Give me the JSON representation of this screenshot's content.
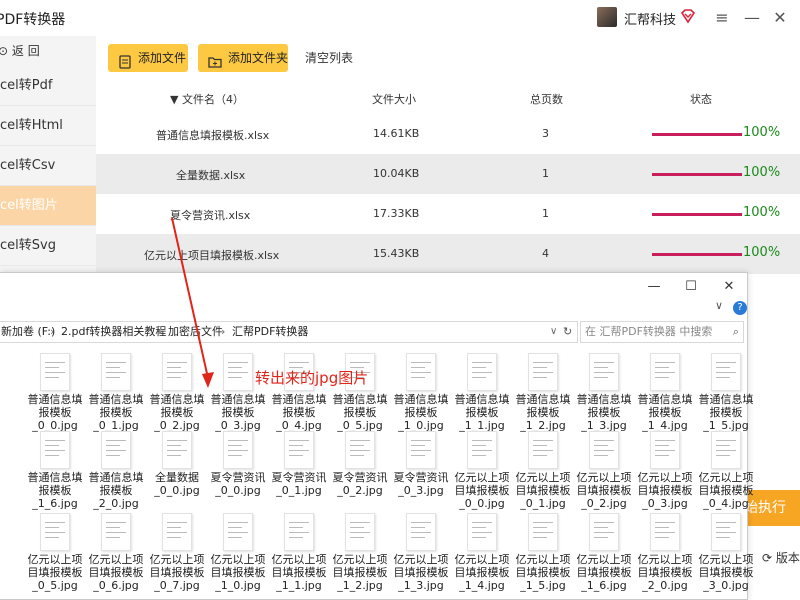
{
  "app": {
    "title": "PDF转换器",
    "brand": "汇帮科技",
    "back": "返 回",
    "sidebar": [
      {
        "label": "cel转Pdf",
        "active": false
      },
      {
        "label": "cel转Html",
        "active": false
      },
      {
        "label": "cel转Csv",
        "active": false
      },
      {
        "label": "cel转图片",
        "active": true
      },
      {
        "label": "cel转Svg",
        "active": false
      }
    ],
    "toolbar": {
      "add_file": "添加文件",
      "add_folder": "添加文件夹",
      "clear": "清空列表"
    },
    "table": {
      "headers": {
        "name": "文件名（4）",
        "size": "文件大小",
        "pages": "总页数",
        "status": "状态"
      },
      "rows": [
        {
          "name": "普通信息填报模板.xlsx",
          "size": "14.61KB",
          "pages": "3",
          "progress": 100,
          "status": "100%"
        },
        {
          "name": "全量数据.xlsx",
          "size": "10.04KB",
          "pages": "1",
          "progress": 100,
          "status": "100%"
        },
        {
          "name": "夏令营资讯.xlsx",
          "size": "17.33KB",
          "pages": "1",
          "progress": 100,
          "status": "100%"
        },
        {
          "name": "亿元以上项目填报模板.xlsx",
          "size": "15.43KB",
          "pages": "4",
          "progress": 100,
          "status": "100%"
        }
      ]
    },
    "start": "始执行",
    "version": "版本"
  },
  "explorer": {
    "path": [
      "新加卷 (F:)",
      "2.pdf转换器相关教程",
      "加密后文件",
      "汇帮PDF转换器"
    ],
    "search_placeholder": "在 汇帮PDF转换器 中搜索",
    "files": [
      [
        "普通信息填",
        "报模板",
        "_0_0.jpg"
      ],
      [
        "普通信息填",
        "报模板",
        "_0_1.jpg"
      ],
      [
        "普通信息填",
        "报模板",
        "_0_2.jpg"
      ],
      [
        "普通信息填",
        "报模板",
        "_0_3.jpg"
      ],
      [
        "普通信息填",
        "报模板",
        "_0_4.jpg"
      ],
      [
        "普通信息填",
        "报模板",
        "_0_5.jpg"
      ],
      [
        "普通信息填",
        "报模板",
        "_1_0.jpg"
      ],
      [
        "普通信息填",
        "报模板",
        "_1_1.jpg"
      ],
      [
        "普通信息填",
        "报模板",
        "_1_2.jpg"
      ],
      [
        "普通信息填",
        "报模板",
        "_1_3.jpg"
      ],
      [
        "普通信息填",
        "报模板",
        "_1_4.jpg"
      ],
      [
        "普通信息填",
        "报模板",
        "_1_5.jpg"
      ],
      [
        "普通信息填",
        "报模板",
        "_1_6.jpg"
      ],
      [
        "普通信息填",
        "报模板",
        "_2_0.jpg"
      ],
      [
        "全量数据",
        "_0_0.jpg"
      ],
      [
        "夏令营资讯",
        "_0_0.jpg"
      ],
      [
        "夏令营资讯",
        "_0_1.jpg"
      ],
      [
        "夏令营资讯",
        "_0_2.jpg"
      ],
      [
        "夏令营资讯",
        "_0_3.jpg"
      ],
      [
        "亿元以上项",
        "目填报模板",
        "_0_0.jpg"
      ],
      [
        "亿元以上项",
        "目填报模板",
        "_0_1.jpg"
      ],
      [
        "亿元以上项",
        "目填报模板",
        "_0_2.jpg"
      ],
      [
        "亿元以上项",
        "目填报模板",
        "_0_3.jpg"
      ],
      [
        "亿元以上项",
        "目填报模板",
        "_0_4.jpg"
      ],
      [
        "亿元以上项",
        "目填报模板",
        "_0_5.jpg"
      ],
      [
        "亿元以上项",
        "目填报模板",
        "_0_6.jpg"
      ],
      [
        "亿元以上项",
        "目填报模板",
        "_0_7.jpg"
      ],
      [
        "亿元以上项",
        "目填报模板",
        "_1_0.jpg"
      ],
      [
        "亿元以上项",
        "目填报模板",
        "_1_1.jpg"
      ],
      [
        "亿元以上项",
        "目填报模板",
        "_1_2.jpg"
      ],
      [
        "亿元以上项",
        "目填报模板",
        "_1_3.jpg"
      ],
      [
        "亿元以上项",
        "目填报模板",
        "_1_4.jpg"
      ],
      [
        "亿元以上项",
        "目填报模板",
        "_1_5.jpg"
      ],
      [
        "亿元以上项",
        "目填报模板",
        "_1_6.jpg"
      ],
      [
        "亿元以上项",
        "目填报模板",
        "_2_0.jpg"
      ],
      [
        "亿元以上项",
        "目填报模板",
        "_3_0.jpg"
      ]
    ]
  },
  "annotation": "转出来的jpg图片",
  "colors": {
    "accent": "#fdc943",
    "progress": "#c81e5b",
    "done": "#1a8a1a",
    "active_nav": "#fcd5a6",
    "annotation": "#e0251b"
  }
}
